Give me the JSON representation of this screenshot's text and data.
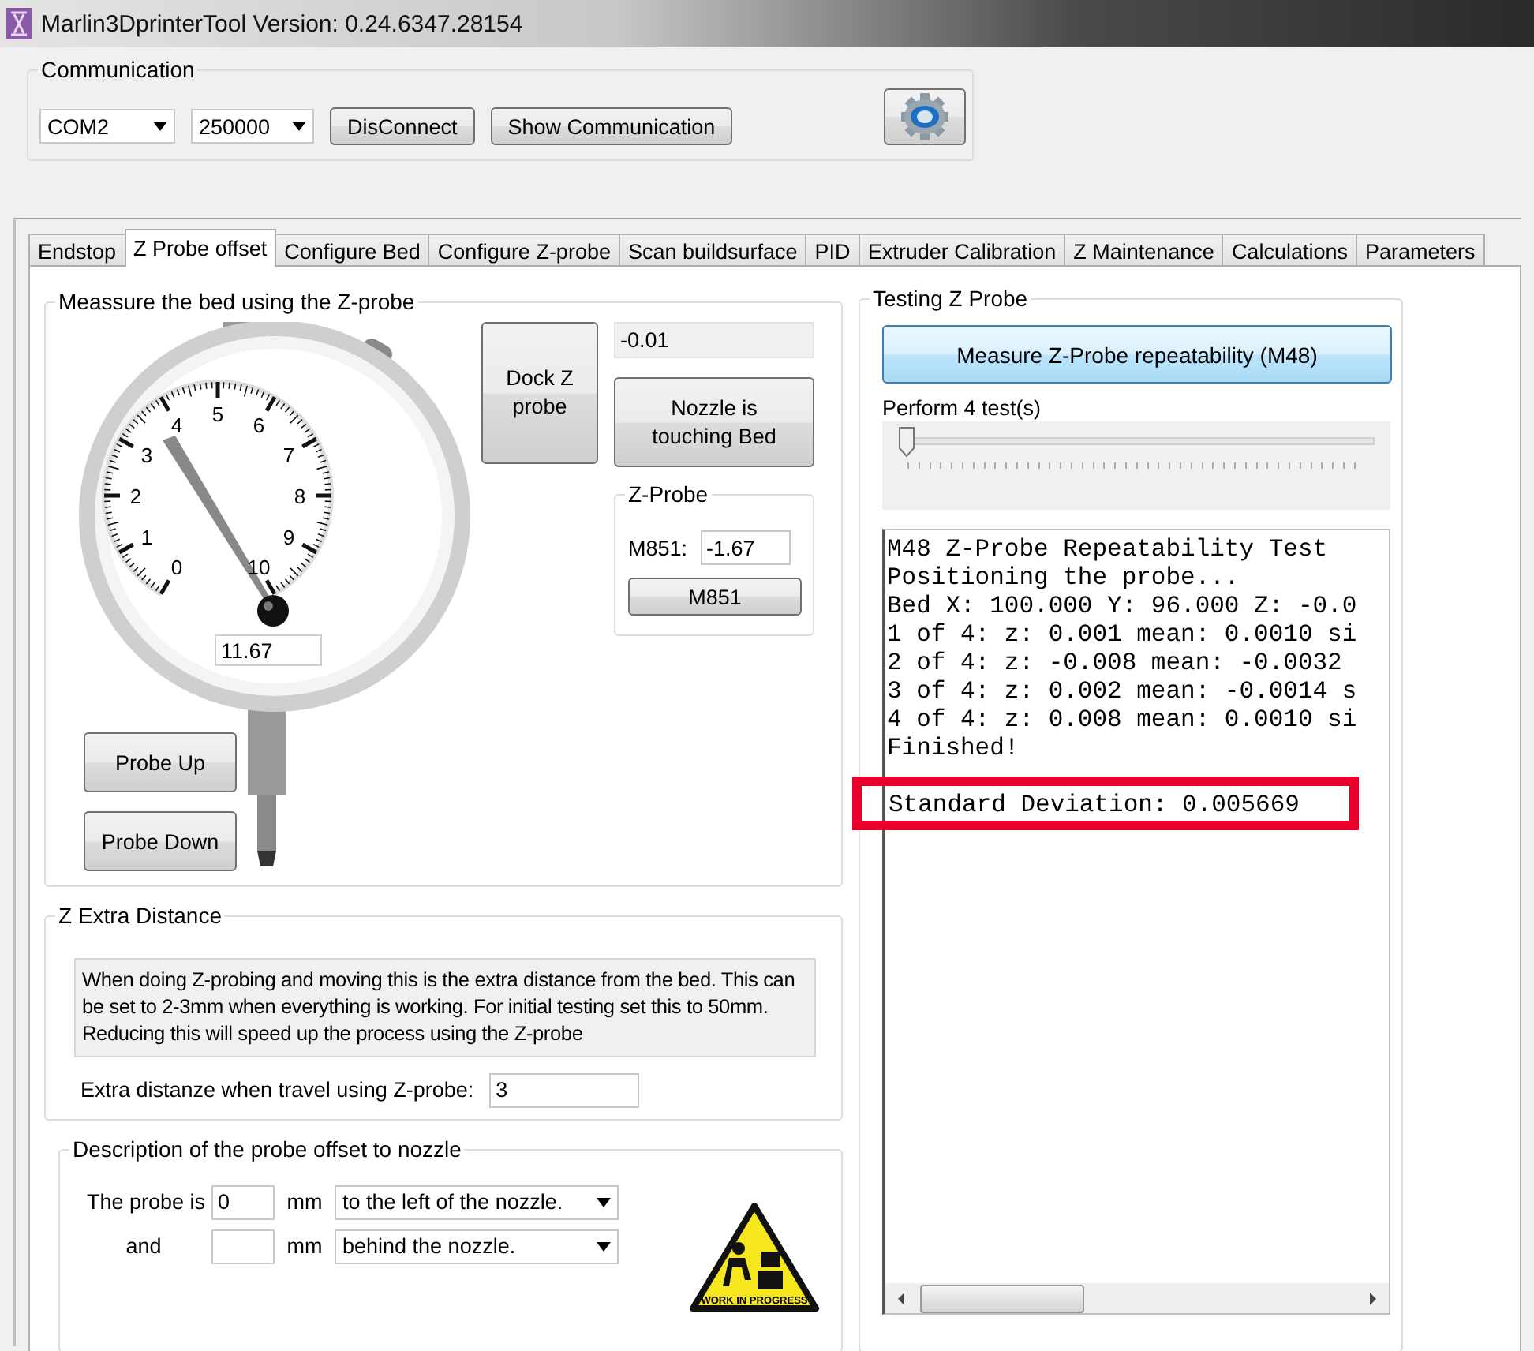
{
  "window": {
    "title": "Marlin3DprinterTool Version: 0.24.6347.28154"
  },
  "communication": {
    "title": "Communication",
    "port": "COM2",
    "baud": "250000",
    "buttons": [
      "DisConnect",
      "Show Communication"
    ]
  },
  "tabs": [
    {
      "label": "Endstop",
      "selected": false
    },
    {
      "label": "Z Probe offset",
      "selected": true
    },
    {
      "label": "Configure Bed",
      "selected": false
    },
    {
      "label": "Configure Z-probe",
      "selected": false
    },
    {
      "label": "Scan buildsurface",
      "selected": false
    },
    {
      "label": "PID",
      "selected": false
    },
    {
      "label": "Extruder Calibration",
      "selected": false
    },
    {
      "label": "Z  Maintenance",
      "selected": false
    },
    {
      "label": "Calculations",
      "selected": false
    },
    {
      "label": "Parameters",
      "selected": false
    }
  ],
  "measure": {
    "title": "Meassure the bed using the Z-probe",
    "dial_labels": [
      "0",
      "1",
      "2",
      "3",
      "4",
      "5",
      "6",
      "7",
      "8",
      "9",
      "10"
    ],
    "gauge_value": "11.67",
    "dock_button": "Dock Z probe",
    "readout": "-0.01",
    "nozzle_button": "Nozzle is touching Bed",
    "probe_up": "Probe Up",
    "probe_down": "Probe Down",
    "zprobe": {
      "title": "Z-Probe",
      "label": "M851:",
      "value": "-1.67",
      "button": "M851"
    }
  },
  "z_extra": {
    "title": "Z Extra Distance",
    "description": "When doing Z-probing and moving this is the extra distance from the bed. This can be set to 2-3mm when everything is working. For initial testing set this to 50mm. Reducing this will speed up the process using the Z-probe",
    "field_label": "Extra distanze when travel using Z-probe:",
    "value": "3"
  },
  "offset": {
    "title": "Description of the probe offset to nozzle",
    "rows": [
      {
        "label": "The probe is",
        "value": "0",
        "unit": "mm",
        "direction": "to the left of the nozzle."
      },
      {
        "label": "and",
        "unit": "mm",
        "direction": "behind the nozzle."
      }
    ],
    "sign_text": "WORK IN PROGRESS"
  },
  "testing": {
    "title": "Testing Z Probe",
    "button": "Measure Z-Probe repeatability (M48)",
    "slider_label": "Perform 4 test(s)",
    "level": 0.0,
    "log": [
      {
        "text": "M48 Z-Probe Repeatability Test",
        "highlighted": false
      },
      {
        "text": "Positioning the probe...",
        "highlighted": false
      },
      {
        "text": "Bed X: 100.000 Y: 96.000 Z: -0.0",
        "highlighted": false
      },
      {
        "text": "1 of 4: z: 0.001 mean: 0.0010 si",
        "highlighted": false
      },
      {
        "text": "2 of 4: z: -0.008 mean: -0.0032",
        "highlighted": false
      },
      {
        "text": "3 of 4: z: 0.002 mean: -0.0014 s",
        "highlighted": false
      },
      {
        "text": "4 of 4: z: 0.008 mean: 0.0010 si",
        "highlighted": false
      },
      {
        "text": "Finished!",
        "highlighted": false
      },
      {
        "text": "Standard Deviation: 0.005669",
        "highlighted": true
      }
    ]
  }
}
